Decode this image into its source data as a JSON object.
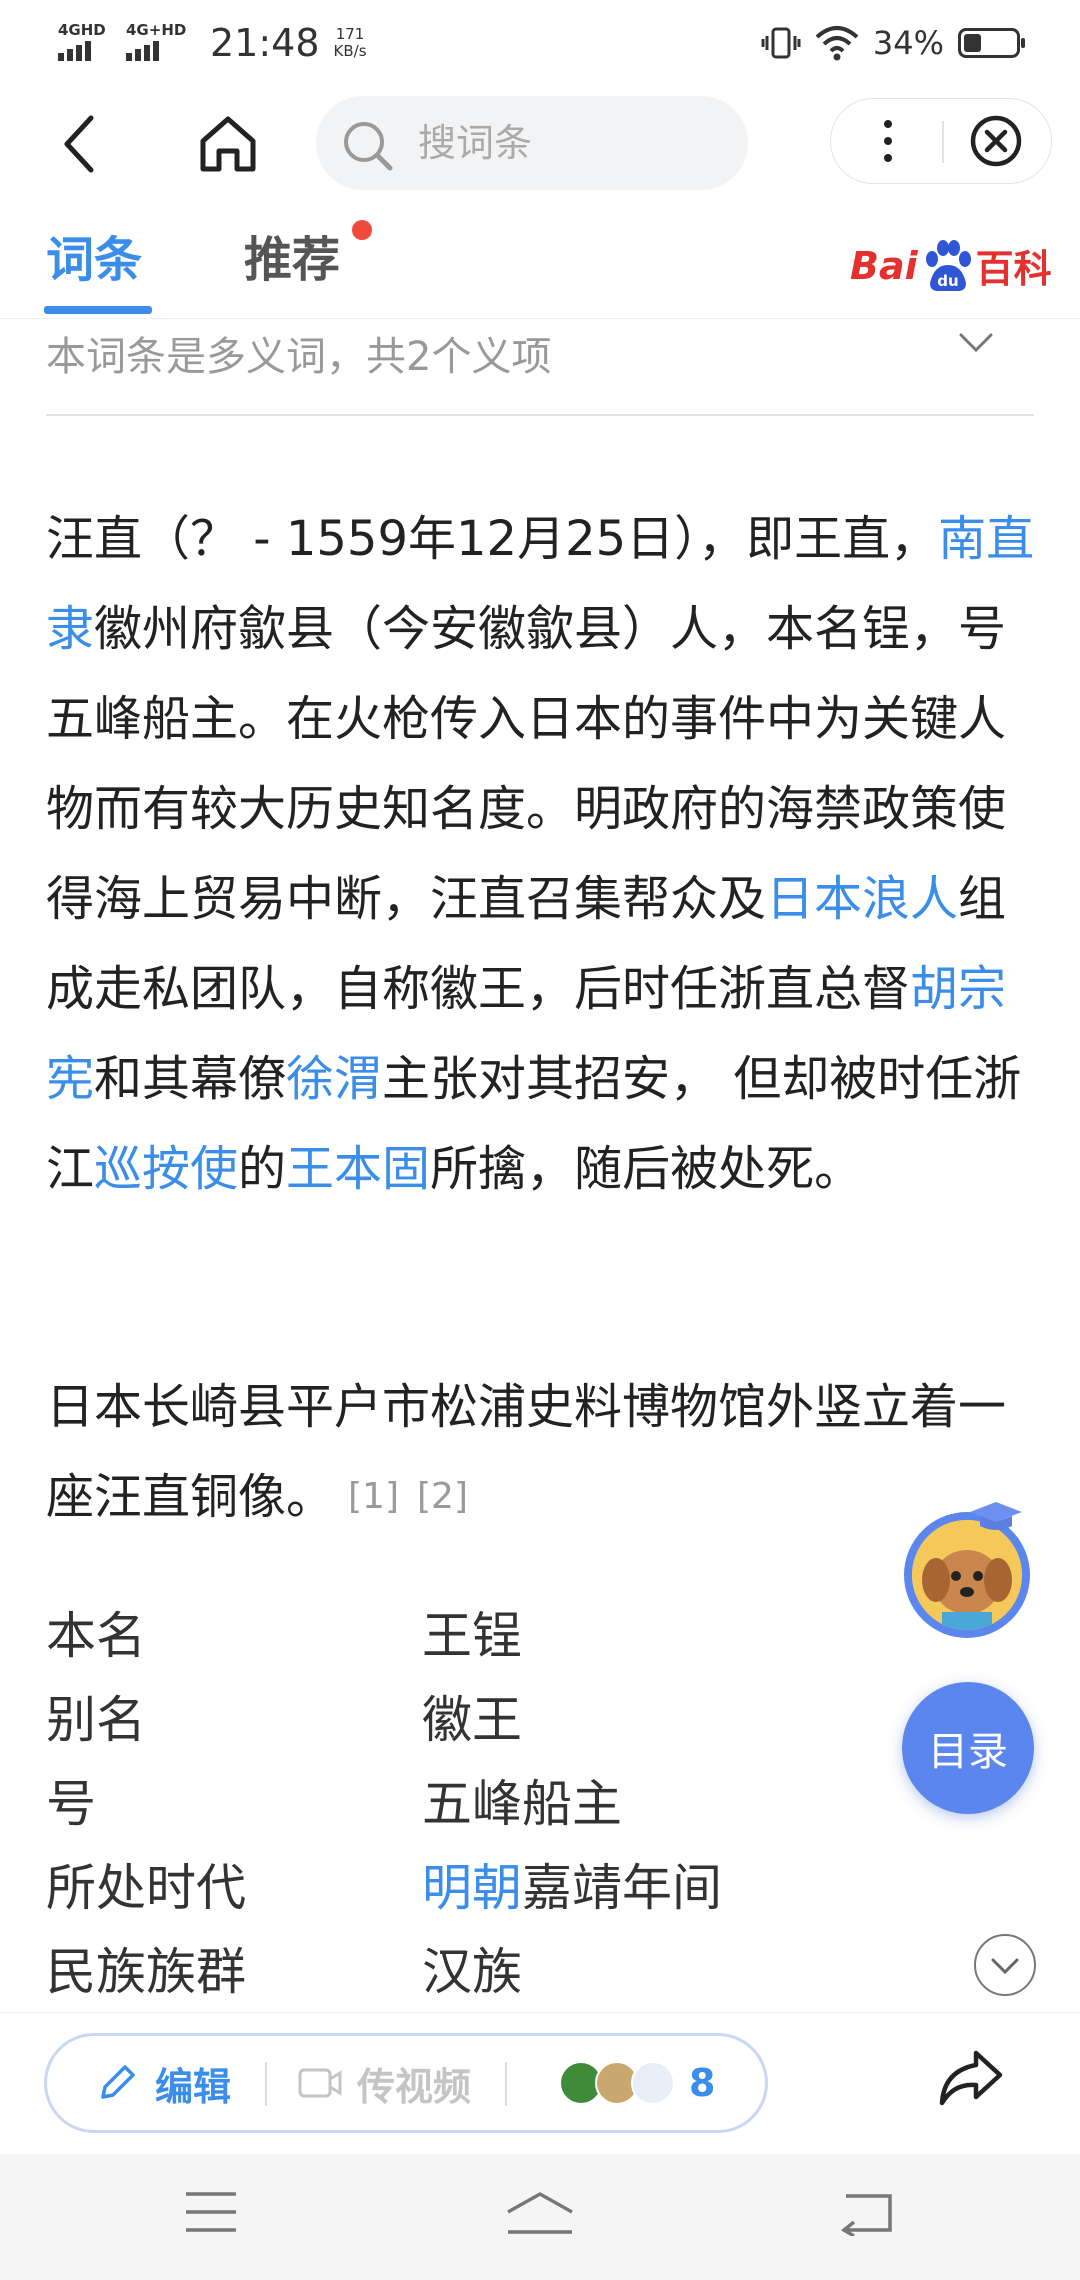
{
  "status_bar": {
    "sim1": "4GHD",
    "sim2": "4G+HD",
    "time": "21:48",
    "speed_value": "171",
    "speed_unit": "KB/s",
    "battery": "34%",
    "battery_level": 0.34
  },
  "search": {
    "placeholder": "搜词条"
  },
  "tabs": [
    {
      "label": "词条",
      "active": true
    },
    {
      "label": "推荐",
      "active": false
    }
  ],
  "logo": {
    "bai": "Bai",
    "du": "du",
    "baike": "百科"
  },
  "polysemy": {
    "text": "本词条是多义词，共2个义项"
  },
  "article": {
    "p1": [
      "汪直（？ - 1559年12月25日），即王直，",
      "南直隶",
      "徽州府歙县（今安徽歙县）人，本名锃，号五峰船主。在火枪传入日本的事件中为关键人物而有较大历史知名度。明政府的海禁政策使得海上贸易中断，汪直召集帮众及",
      "日本浪人",
      "组成走私团队，自称徽王，后时任浙直总督",
      "胡宗宪",
      "和其幕僚",
      "徐渭",
      "主张对其招安， 但却被时任浙江",
      "巡按使",
      "的",
      "王本固",
      "所擒，随后被处死。"
    ],
    "p2": "日本长崎县平户市松浦史料博物馆外竖立着一座汪直铜像。",
    "refs": [
      "[1]",
      "[2]"
    ]
  },
  "info": [
    {
      "key": "本名",
      "value": "王锃"
    },
    {
      "key": "别名",
      "value": "徽王"
    },
    {
      "key": "号",
      "value": "五峰船主"
    },
    {
      "key": "所处时代",
      "value_link": "明朝",
      "value": "嘉靖年间"
    },
    {
      "key": "民族族群",
      "value": "汉族"
    }
  ],
  "toc_label": "目录",
  "actions": {
    "edit": "编辑",
    "video": "传视频",
    "contributors": "8"
  }
}
